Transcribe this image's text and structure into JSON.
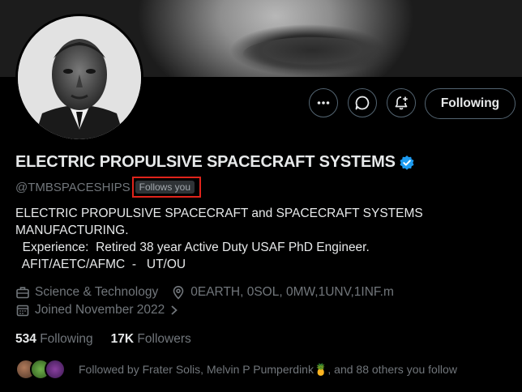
{
  "header": {
    "name": "ELECTRIC PROPULSIVE SPACECRAFT SYSTEMS",
    "handle": "@TMBSPACESHIPS",
    "follows_you": "Follows you"
  },
  "actions": {
    "more_icon": "more-horizontal-icon",
    "message_icon": "message-bubble-icon",
    "notify_icon": "bell-plus-icon",
    "following_label": "Following"
  },
  "bio": {
    "lines": [
      "ELECTRIC PROPULSIVE SPACECRAFT and SPACECRAFT SYSTEMS",
      "MANUFACTURING.",
      "  Experience:  Retired 38 year Active Duty USAF PhD Engineer.",
      "  AFIT/AETC/AFMC  -   UT/OU"
    ]
  },
  "meta": {
    "category": "Science & Technology",
    "location": "0EARTH, 0SOL, 0MW,1UNV,1INF.m",
    "joined": "Joined November 2022"
  },
  "stats": {
    "following_count": "534",
    "following_label": "Following",
    "followers_count": "17K",
    "followers_label": "Followers"
  },
  "followed_by": {
    "text": "Followed by Frater Solis, Melvin P Pumperdink🍍, and 88 others you follow"
  },
  "colors": {
    "background": "#000000",
    "text_primary": "#e7e9ea",
    "text_secondary": "#71767b",
    "verified": "#1d9bf0",
    "highlight_box": "#e0241b"
  }
}
